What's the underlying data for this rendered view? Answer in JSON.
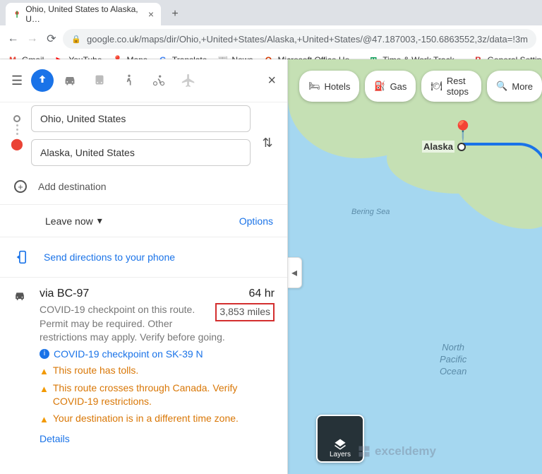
{
  "browser": {
    "tab_title": "Ohio, United States to Alaska, U…",
    "url": "google.co.uk/maps/dir/Ohio,+United+States/Alaska,+United+States/@47.187003,-150.6863552,3z/data=!3m",
    "bookmarks": [
      {
        "label": "Gmail",
        "icon": "M",
        "color": "#ea4335"
      },
      {
        "label": "YouTube",
        "icon": "▶",
        "color": "#ff0000"
      },
      {
        "label": "Maps",
        "icon": "📍",
        "color": "#34a853"
      },
      {
        "label": "Translate",
        "icon": "G",
        "color": "#4285f4"
      },
      {
        "label": "News",
        "icon": "📰",
        "color": "#4285f4"
      },
      {
        "label": "Microsoft Office Ho…",
        "icon": "O",
        "color": "#d83b01"
      },
      {
        "label": "Time & Work Track…",
        "icon": "⊞",
        "color": "#0f9d58"
      },
      {
        "label": "General Setting…",
        "icon": "B",
        "color": "#d32f2f"
      }
    ]
  },
  "directions": {
    "origin": "Ohio, United States",
    "destination": "Alaska, United States",
    "add_destination": "Add destination",
    "depart": "Leave now",
    "options": "Options",
    "send_phone": "Send directions to your phone"
  },
  "route": {
    "title": "via BC-97",
    "duration": "64 hr",
    "distance": "3,853 miles",
    "note": "COVID-19 checkpoint on this route. Permit may be required. Other restrictions may apply. Verify before going.",
    "info1": "COVID-19 checkpoint on SK-39 N",
    "warn1": "This route has tolls.",
    "warn2": "This route crosses through Canada. Verify COVID-19 restrictions.",
    "warn3": "Your destination is in a different time zone.",
    "details": "Details"
  },
  "map": {
    "pills": [
      "Hotels",
      "Gas",
      "Rest stops",
      "More"
    ],
    "pill_icons": [
      "🛏",
      "⛽",
      "🍽",
      "🔍"
    ],
    "bering": "Bering Sea",
    "ocean": "North\nPacific\nOcean",
    "dest_label": "Alaska",
    "layers": "Layers"
  },
  "watermark": "exceldemy"
}
